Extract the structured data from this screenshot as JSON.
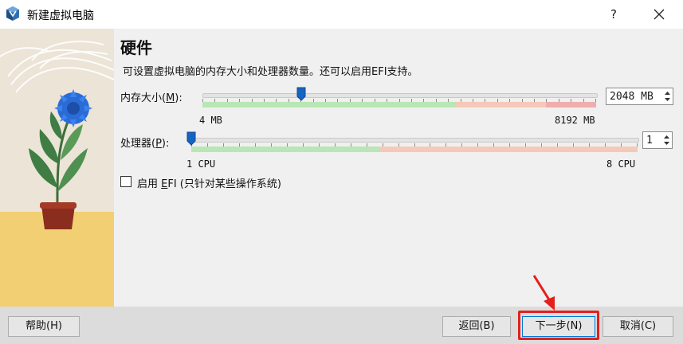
{
  "window": {
    "title": "新建虚拟电脑",
    "help": "?"
  },
  "page": {
    "heading": "硬件",
    "description": "可设置虚拟电脑的内存大小和处理器数量。还可以启用EFI支持。"
  },
  "memory": {
    "label_prefix": "内存大小(",
    "label_key": "M",
    "label_suffix": "):",
    "value": "2048 MB",
    "value_mb": 2048,
    "min_label": "4 MB",
    "max_label": "8192 MB",
    "min": 4,
    "max": 8192
  },
  "cpu": {
    "label_prefix": "处理器(",
    "label_key": "P",
    "label_suffix": "):",
    "value": "1",
    "min_label": "1 CPU",
    "max_label": "8 CPU",
    "min": 1,
    "max": 8
  },
  "efi": {
    "checked": false,
    "label_prefix": "启用 ",
    "label_key": "E",
    "label_suffix": "FI (只针对某些操作系统)"
  },
  "buttons": {
    "help": "帮助(H)",
    "back": "返回(B)",
    "next": "下一步(N)",
    "cancel": "取消(C)"
  },
  "colors": {
    "safe": "#b7e4b2",
    "warn": "#f5c8b4",
    "danger": "#f0b0b0",
    "thumb": "#1565c0",
    "highlight": "#e3201b"
  }
}
